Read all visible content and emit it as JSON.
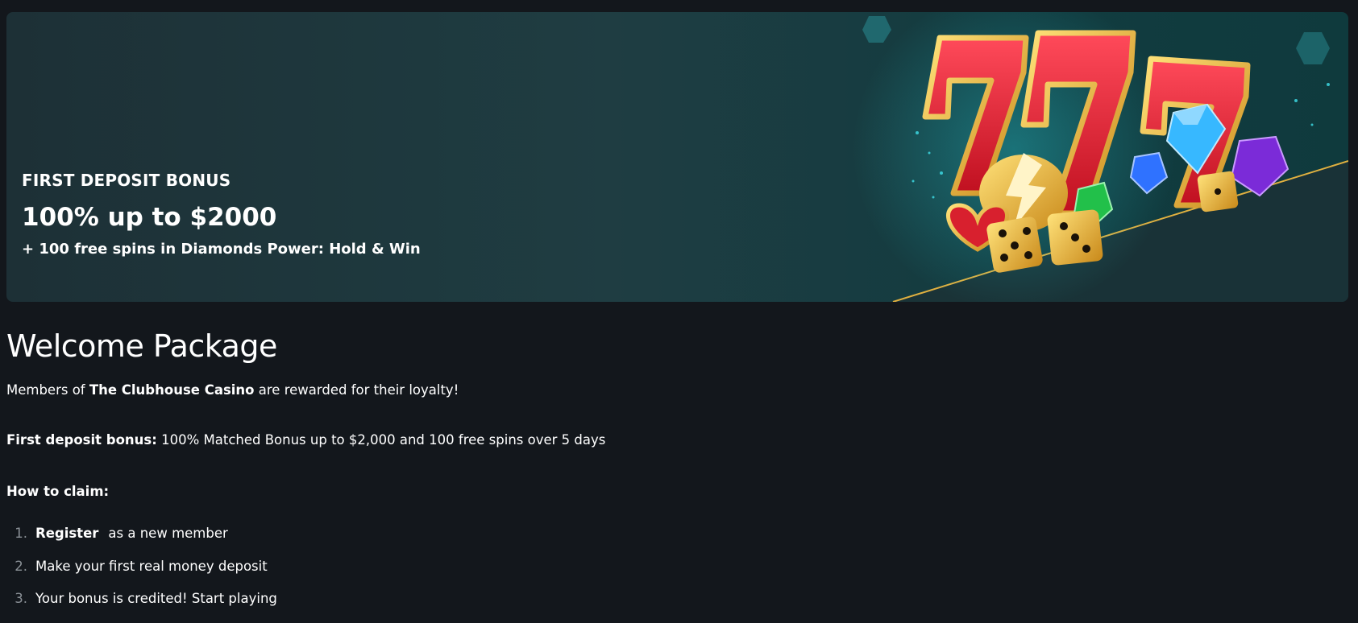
{
  "banner": {
    "label": "FIRST DEPOSIT BONUS",
    "amount": "100% up to $2000",
    "spins": "+ 100 free spins in Diamonds Power: Hold & Win",
    "art_icons": [
      "lucky-seven-icon",
      "diamond-icon",
      "gem-icon",
      "dice-icon",
      "heart-icon",
      "lightning-icon"
    ],
    "colors": {
      "bg": "#1f3d42",
      "seven": "#e8242e",
      "gold": "#f2c230",
      "diamond_blue": "#2fb0ff",
      "gem_purple": "#7a2bd8",
      "gem_green": "#22c04a"
    }
  },
  "content": {
    "title": "Welcome Package",
    "intro_prefix": "Members of ",
    "intro_brand": "The Clubhouse Casino",
    "intro_suffix": " are rewarded for their loyalty!",
    "first_deposit_label": "First deposit bonus:",
    "first_deposit_text": " 100% Matched Bonus up to $2,000 and 100 free spins over 5 days",
    "how_to_label": "How to claim:",
    "steps": [
      {
        "num": "1.",
        "link": "Register",
        "text": "as a new member"
      },
      {
        "num": "2.",
        "link": "",
        "text": "Make your first real money deposit"
      },
      {
        "num": "3.",
        "link": "",
        "text": "Your bonus is credited! Start playing"
      }
    ]
  }
}
